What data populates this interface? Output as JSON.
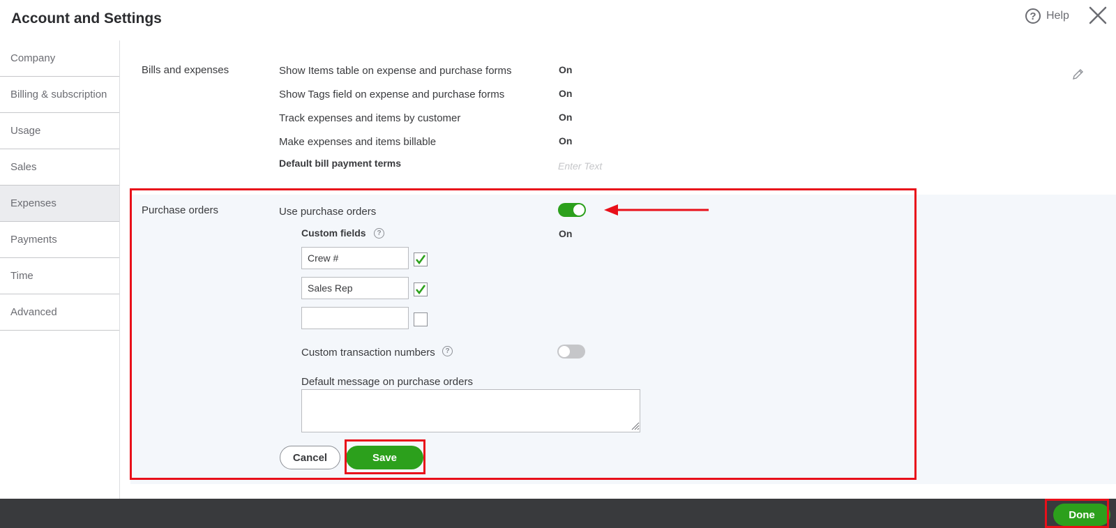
{
  "header": {
    "title": "Account and Settings",
    "help_label": "Help"
  },
  "sidebar": {
    "items": [
      {
        "label": "Company"
      },
      {
        "label": "Billing & subscription"
      },
      {
        "label": "Usage"
      },
      {
        "label": "Sales"
      },
      {
        "label": "Expenses",
        "active": true
      },
      {
        "label": "Payments"
      },
      {
        "label": "Time"
      },
      {
        "label": "Advanced"
      }
    ]
  },
  "bills": {
    "section_label": "Bills and expenses",
    "rows": [
      {
        "label": "Show Items table on expense and purchase forms",
        "value": "On"
      },
      {
        "label": "Show Tags field on expense and purchase forms",
        "value": "On"
      },
      {
        "label": "Track expenses and items by customer",
        "value": "On"
      },
      {
        "label": "Make expenses and items billable",
        "value": "On"
      }
    ],
    "default_terms_label": "Default bill payment terms",
    "default_terms_placeholder": "Enter Text"
  },
  "purchase_orders": {
    "section_label": "Purchase orders",
    "use_po_label": "Use purchase orders",
    "use_po_enabled": true,
    "custom_fields_label": "Custom fields",
    "custom_fields_value": "On",
    "custom_fields": [
      {
        "value": "Crew #",
        "checked": true
      },
      {
        "value": "Sales Rep",
        "checked": true
      },
      {
        "value": "",
        "checked": false
      }
    ],
    "custom_txn_label": "Custom transaction numbers",
    "custom_txn_enabled": false,
    "default_message_label": "Default message on purchase orders",
    "default_message_value": ""
  },
  "buttons": {
    "cancel": "Cancel",
    "save": "Save",
    "done": "Done"
  },
  "colors": {
    "accent_green": "#2ca01c",
    "highlight_red": "#e8101a",
    "footer_dark": "#393a3d",
    "panel_bg": "#f4f7fb"
  }
}
